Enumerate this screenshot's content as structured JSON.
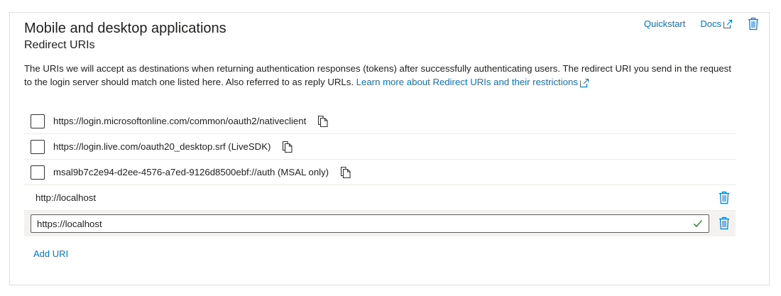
{
  "section": {
    "title": "Mobile and desktop applications",
    "subtitle": "Redirect URIs"
  },
  "actions": {
    "quickstart": "Quickstart",
    "docs": "Docs"
  },
  "description": {
    "text": "The URIs we will accept as destinations when returning authentication responses (tokens) after successfully authenticating users. The redirect URI you send in the request to the login server should match one listed here. Also referred to as reply URLs. ",
    "link": "Learn more about Redirect URIs and their restrictions"
  },
  "suggested_uris": [
    {
      "uri": "https://login.microsoftonline.com/common/oauth2/nativeclient",
      "checked": false
    },
    {
      "uri": "https://login.live.com/oauth20_desktop.srf (LiveSDK)",
      "checked": false
    },
    {
      "uri": "msal9b7c2e94-d2ee-4576-a7ed-9126d8500ebf://auth (MSAL only)",
      "checked": false
    }
  ],
  "custom_uris": [
    {
      "uri": "http://localhost"
    }
  ],
  "editing_uri": {
    "value": "https://localhost",
    "valid": true
  },
  "add_uri_label": "Add URI",
  "colors": {
    "accent": "#0078d4",
    "valid": "#107c10",
    "border": "#e1dfdd"
  },
  "icons": [
    "external-link-icon",
    "trash-icon",
    "copy-icon",
    "checkmark-icon"
  ]
}
